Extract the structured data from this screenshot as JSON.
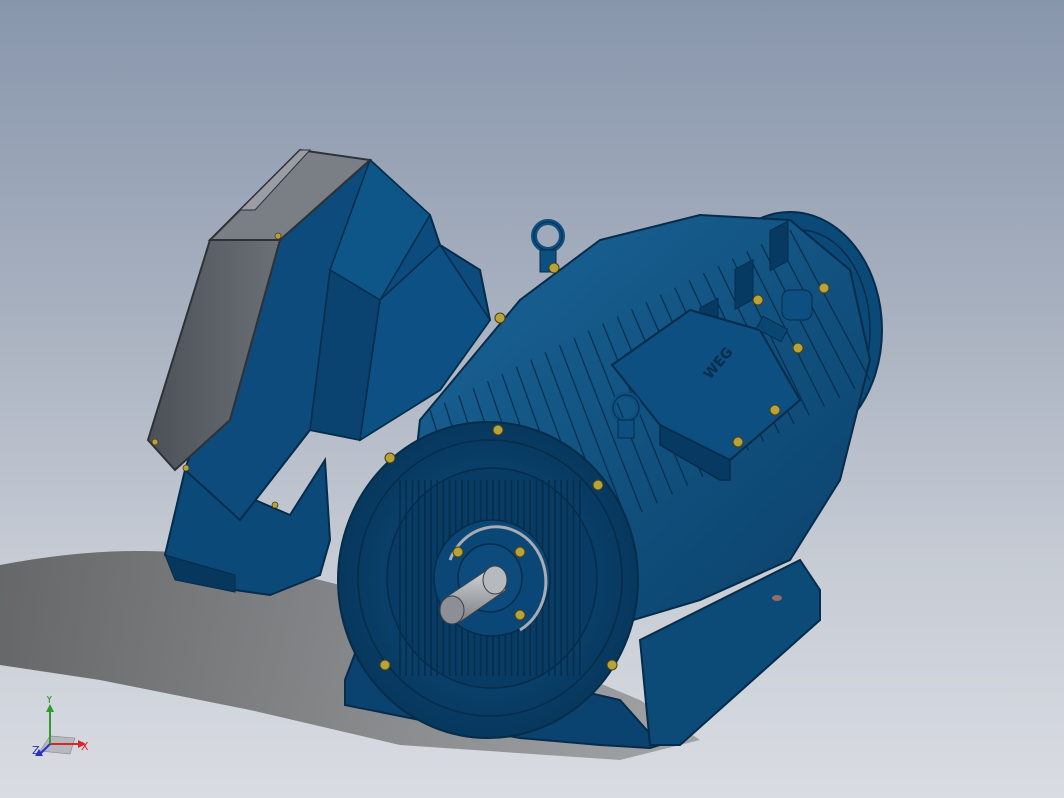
{
  "viewport": {
    "background_top": "#8896ac",
    "background_bottom": "#d9dce2"
  },
  "model": {
    "body_color": "#0c4a78",
    "body_dark": "#062d4d",
    "body_light": "#1a6699",
    "cover_color": "#5a5f66",
    "bolt_color": "#b8a23a",
    "shaft_color": "#a9adb3",
    "nameplate_logo": "WEG"
  },
  "triad": {
    "x_label": "X",
    "y_label": "Y",
    "z_label": "Z",
    "x_color": "#d62828",
    "y_color": "#2e9b2e",
    "z_color": "#2432c8"
  }
}
